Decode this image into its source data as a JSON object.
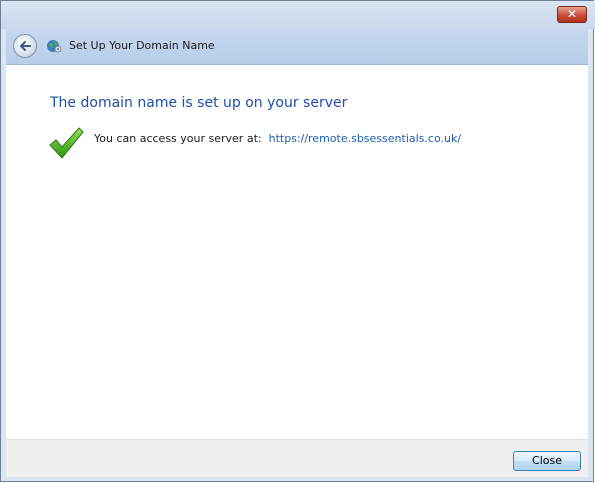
{
  "window": {
    "close_glyph": "✕"
  },
  "header": {
    "title": "Set Up Your Domain Name",
    "back_icon": "back-arrow-icon",
    "app_icon": "globe-network-icon"
  },
  "content": {
    "heading": "The domain name is set up on your server",
    "status_icon": "green-checkmark-icon",
    "access_text": "You can access your server at:",
    "server_url": "https://remote.sbsessentials.co.uk/"
  },
  "footer": {
    "close_label": "Close"
  },
  "colors": {
    "heading": "#1e4fa7",
    "link": "#1c5fb5",
    "check": "#3fae1c",
    "header_bg": "#b8cde9"
  }
}
